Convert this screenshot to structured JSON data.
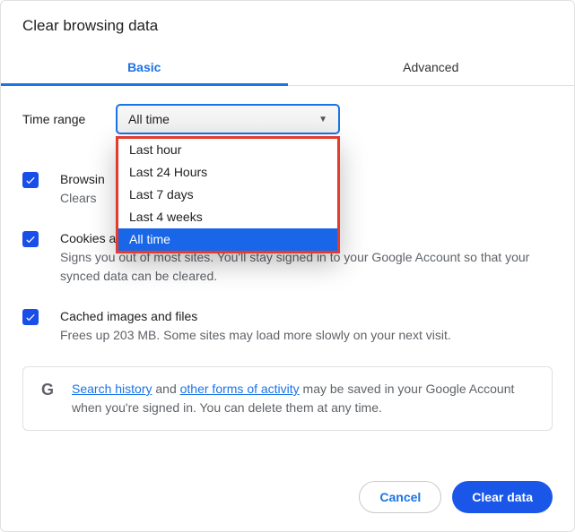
{
  "dialog": {
    "title": "Clear browsing data"
  },
  "tabs": {
    "basic": "Basic",
    "advanced": "Advanced"
  },
  "timeRange": {
    "label": "Time range",
    "selected": "All time",
    "options": {
      "o0": "Last hour",
      "o1": "Last 24 Hours",
      "o2": "Last 7 days",
      "o3": "Last 4 weeks",
      "o4": "All time"
    }
  },
  "items": {
    "history": {
      "title": "Browsin",
      "desc": "Clears "
    },
    "cookies": {
      "title": "Cookies and other site data",
      "desc": "Signs you out of most sites. You'll stay signed in to your Google Account so that your synced data can be cleared."
    },
    "cache": {
      "title": "Cached images and files",
      "desc": "Frees up 203 MB. Some sites may load more slowly on your next visit."
    }
  },
  "notice": {
    "link1": "Search history",
    "mid1": " and ",
    "link2": "other forms of activity",
    "rest": " may be saved in your Google Account when you're signed in. You can delete them at any time."
  },
  "footer": {
    "cancel": "Cancel",
    "clear": "Clear data"
  }
}
